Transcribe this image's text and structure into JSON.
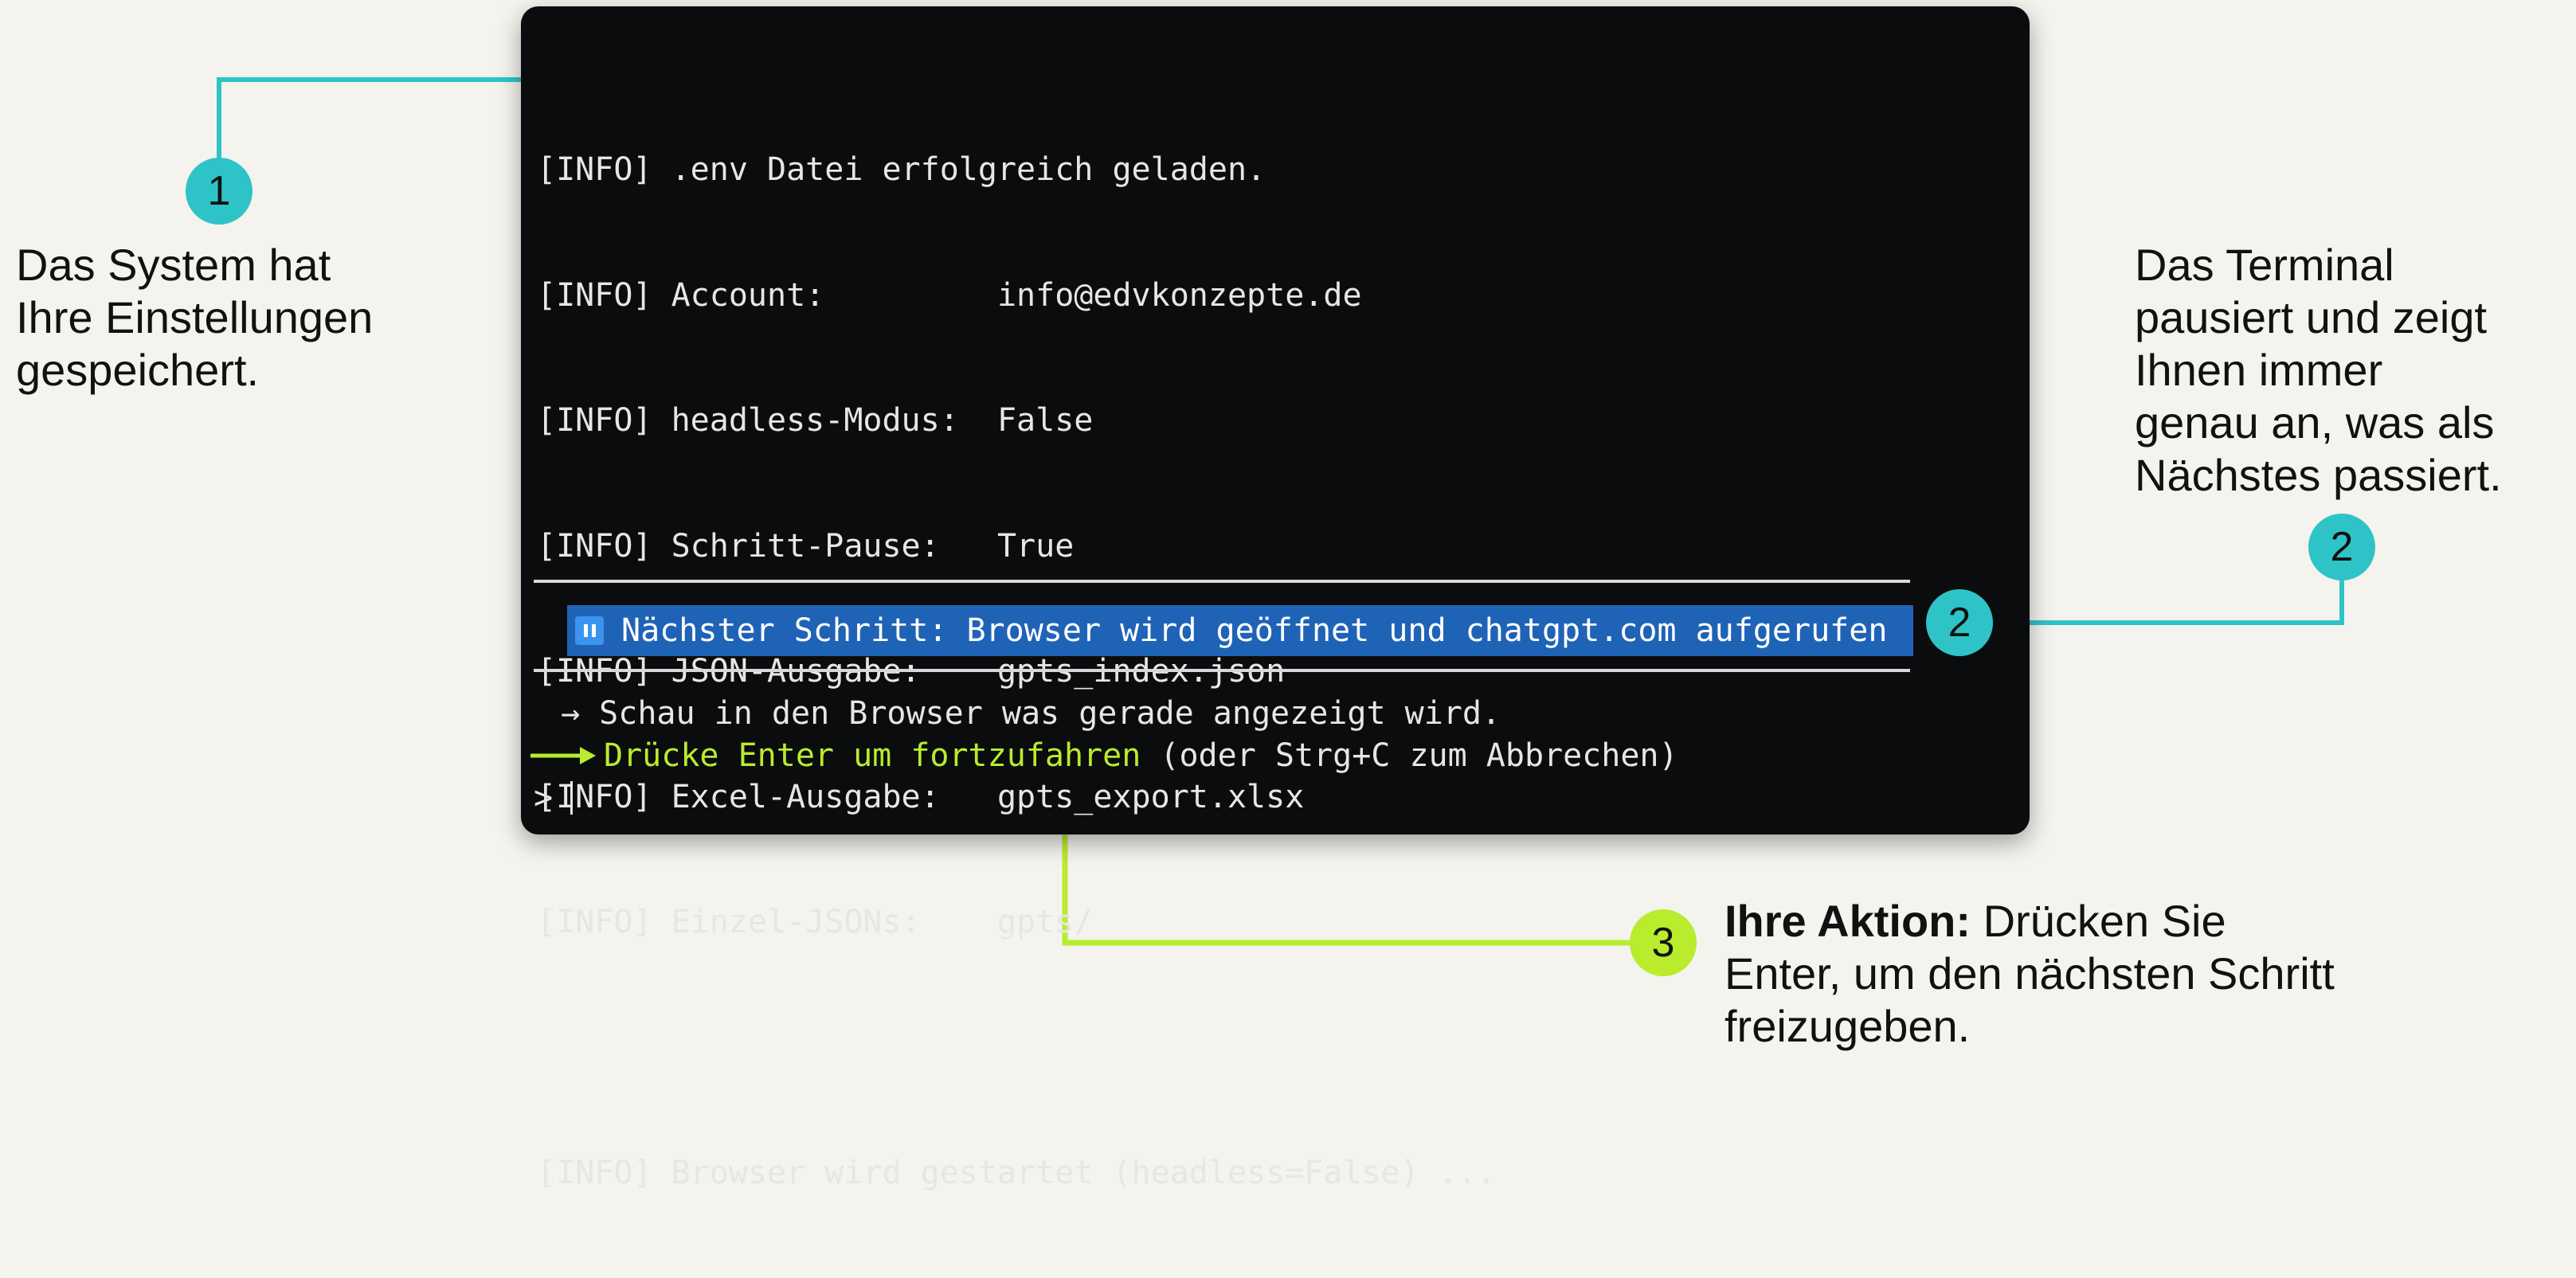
{
  "terminal": {
    "log_lines": [
      "[INFO] .env Datei erfolgreich geladen.",
      "[INFO] Account:         info@edvkonzepte.de",
      "[INFO] headless-Modus:  False",
      "[INFO] Schritt-Pause:   True",
      "[INFO] JSON-Ausgabe:    gpts_index.json",
      "[INFO] Excel-Ausgabe:   gpts_export.xlsx",
      "[INFO] Einzel-JSONs:    gpts/",
      "",
      "[INFO] Browser wird gestartet (headless=False) ..."
    ],
    "next_step_text": "Nächster Schritt: Browser wird geöffnet und chatgpt.com aufgerufen",
    "instruction": "→ Schau in den Browser was gerade angezeigt wird.",
    "prompt_action": "Drücke Enter um fortzufahren",
    "prompt_alt": " (oder Strg+C zum Abbrechen)",
    "cursor_prompt": ">"
  },
  "annotations": {
    "one": {
      "badge": "1",
      "text_lines": [
        "Das System hat",
        "Ihre Einstellungen",
        "gespeichert."
      ]
    },
    "two": {
      "badge": "2",
      "text_lines": [
        "Das Terminal",
        "pausiert und zeigt",
        "Ihnen immer",
        "genau an, was als",
        "Nächstes passiert."
      ]
    },
    "two_inline_badge": "2",
    "three": {
      "badge": "3",
      "bold_prefix": "Ihre Aktion:",
      "line1_rest": " Drücken Sie",
      "line2": "Enter, um den nächsten Schritt",
      "line3": "freizugeben."
    }
  },
  "colors": {
    "teal": "#2ec4c7",
    "lime": "#b8ec2c",
    "highlight_blue": "#1f63b6",
    "terminal_bg": "#0b0c0e",
    "page_bg": "#f4f3ee"
  }
}
